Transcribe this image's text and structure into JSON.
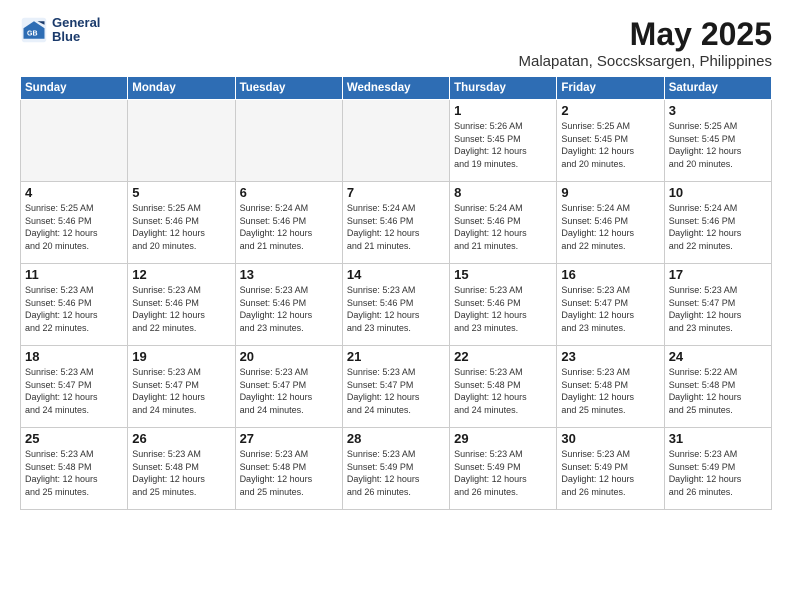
{
  "logo": {
    "line1": "General",
    "line2": "Blue"
  },
  "title": "May 2025",
  "location": "Malapatan, Soccsksargen, Philippines",
  "weekdays": [
    "Sunday",
    "Monday",
    "Tuesday",
    "Wednesday",
    "Thursday",
    "Friday",
    "Saturday"
  ],
  "weeks": [
    [
      {
        "day": "",
        "info": ""
      },
      {
        "day": "",
        "info": ""
      },
      {
        "day": "",
        "info": ""
      },
      {
        "day": "",
        "info": ""
      },
      {
        "day": "1",
        "info": "Sunrise: 5:26 AM\nSunset: 5:45 PM\nDaylight: 12 hours\nand 19 minutes."
      },
      {
        "day": "2",
        "info": "Sunrise: 5:25 AM\nSunset: 5:45 PM\nDaylight: 12 hours\nand 20 minutes."
      },
      {
        "day": "3",
        "info": "Sunrise: 5:25 AM\nSunset: 5:45 PM\nDaylight: 12 hours\nand 20 minutes."
      }
    ],
    [
      {
        "day": "4",
        "info": "Sunrise: 5:25 AM\nSunset: 5:46 PM\nDaylight: 12 hours\nand 20 minutes."
      },
      {
        "day": "5",
        "info": "Sunrise: 5:25 AM\nSunset: 5:46 PM\nDaylight: 12 hours\nand 20 minutes."
      },
      {
        "day": "6",
        "info": "Sunrise: 5:24 AM\nSunset: 5:46 PM\nDaylight: 12 hours\nand 21 minutes."
      },
      {
        "day": "7",
        "info": "Sunrise: 5:24 AM\nSunset: 5:46 PM\nDaylight: 12 hours\nand 21 minutes."
      },
      {
        "day": "8",
        "info": "Sunrise: 5:24 AM\nSunset: 5:46 PM\nDaylight: 12 hours\nand 21 minutes."
      },
      {
        "day": "9",
        "info": "Sunrise: 5:24 AM\nSunset: 5:46 PM\nDaylight: 12 hours\nand 22 minutes."
      },
      {
        "day": "10",
        "info": "Sunrise: 5:24 AM\nSunset: 5:46 PM\nDaylight: 12 hours\nand 22 minutes."
      }
    ],
    [
      {
        "day": "11",
        "info": "Sunrise: 5:23 AM\nSunset: 5:46 PM\nDaylight: 12 hours\nand 22 minutes."
      },
      {
        "day": "12",
        "info": "Sunrise: 5:23 AM\nSunset: 5:46 PM\nDaylight: 12 hours\nand 22 minutes."
      },
      {
        "day": "13",
        "info": "Sunrise: 5:23 AM\nSunset: 5:46 PM\nDaylight: 12 hours\nand 23 minutes."
      },
      {
        "day": "14",
        "info": "Sunrise: 5:23 AM\nSunset: 5:46 PM\nDaylight: 12 hours\nand 23 minutes."
      },
      {
        "day": "15",
        "info": "Sunrise: 5:23 AM\nSunset: 5:46 PM\nDaylight: 12 hours\nand 23 minutes."
      },
      {
        "day": "16",
        "info": "Sunrise: 5:23 AM\nSunset: 5:47 PM\nDaylight: 12 hours\nand 23 minutes."
      },
      {
        "day": "17",
        "info": "Sunrise: 5:23 AM\nSunset: 5:47 PM\nDaylight: 12 hours\nand 23 minutes."
      }
    ],
    [
      {
        "day": "18",
        "info": "Sunrise: 5:23 AM\nSunset: 5:47 PM\nDaylight: 12 hours\nand 24 minutes."
      },
      {
        "day": "19",
        "info": "Sunrise: 5:23 AM\nSunset: 5:47 PM\nDaylight: 12 hours\nand 24 minutes."
      },
      {
        "day": "20",
        "info": "Sunrise: 5:23 AM\nSunset: 5:47 PM\nDaylight: 12 hours\nand 24 minutes."
      },
      {
        "day": "21",
        "info": "Sunrise: 5:23 AM\nSunset: 5:47 PM\nDaylight: 12 hours\nand 24 minutes."
      },
      {
        "day": "22",
        "info": "Sunrise: 5:23 AM\nSunset: 5:48 PM\nDaylight: 12 hours\nand 24 minutes."
      },
      {
        "day": "23",
        "info": "Sunrise: 5:23 AM\nSunset: 5:48 PM\nDaylight: 12 hours\nand 25 minutes."
      },
      {
        "day": "24",
        "info": "Sunrise: 5:22 AM\nSunset: 5:48 PM\nDaylight: 12 hours\nand 25 minutes."
      }
    ],
    [
      {
        "day": "25",
        "info": "Sunrise: 5:23 AM\nSunset: 5:48 PM\nDaylight: 12 hours\nand 25 minutes."
      },
      {
        "day": "26",
        "info": "Sunrise: 5:23 AM\nSunset: 5:48 PM\nDaylight: 12 hours\nand 25 minutes."
      },
      {
        "day": "27",
        "info": "Sunrise: 5:23 AM\nSunset: 5:48 PM\nDaylight: 12 hours\nand 25 minutes."
      },
      {
        "day": "28",
        "info": "Sunrise: 5:23 AM\nSunset: 5:49 PM\nDaylight: 12 hours\nand 26 minutes."
      },
      {
        "day": "29",
        "info": "Sunrise: 5:23 AM\nSunset: 5:49 PM\nDaylight: 12 hours\nand 26 minutes."
      },
      {
        "day": "30",
        "info": "Sunrise: 5:23 AM\nSunset: 5:49 PM\nDaylight: 12 hours\nand 26 minutes."
      },
      {
        "day": "31",
        "info": "Sunrise: 5:23 AM\nSunset: 5:49 PM\nDaylight: 12 hours\nand 26 minutes."
      }
    ]
  ]
}
